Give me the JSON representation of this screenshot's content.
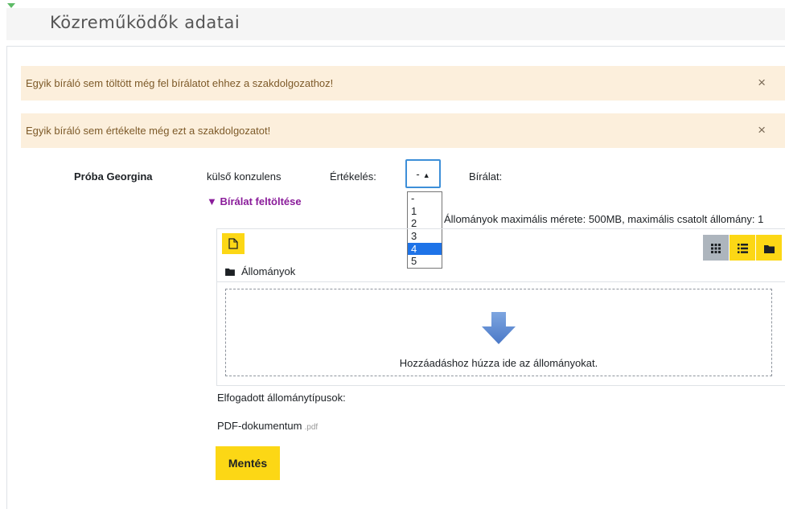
{
  "section": {
    "title": "Közreműködők adatai"
  },
  "alerts": [
    {
      "text": "Egyik bíráló sem töltött még fel bírálatot ehhez a szakdolgozathoz!",
      "close": "×"
    },
    {
      "text": "Egyik bíráló sem értékelte még ezt a szakdolgozatot!",
      "close": "×"
    }
  ],
  "reviewer": {
    "name": "Próba Georgina",
    "role": "külső konzulens",
    "grade_label": "Értékelés:",
    "review_label": "Bírálat:"
  },
  "grade_select": {
    "value": "-",
    "options": [
      "-",
      "1",
      "2",
      "3",
      "4",
      "5"
    ],
    "highlighted": "4"
  },
  "upload": {
    "toggle_label": "▼ Bírálat feltöltése",
    "limits": "Állományok maximális mérete: 500MB, maximális csatolt állomány: 1",
    "path_label": "Állományok",
    "drop_hint": "Hozzáadáshoz húzza ide az állományokat.",
    "accepted_label": "Elfogadott állománytípusok:",
    "file_type": "PDF-dokumentum",
    "file_ext": ".pdf"
  },
  "actions": {
    "save_label": "Mentés"
  },
  "colors": {
    "accent": "#fcd715",
    "alert_bg": "#fcefdc",
    "focus": "#3d8fd8",
    "link": "#8a1c9a"
  },
  "icons": [
    "collapse-triangle-icon",
    "close-icon",
    "add-file-icon",
    "grid-view-icon",
    "list-view-icon",
    "folder-view-icon",
    "folder-icon",
    "drop-arrow-icon"
  ]
}
